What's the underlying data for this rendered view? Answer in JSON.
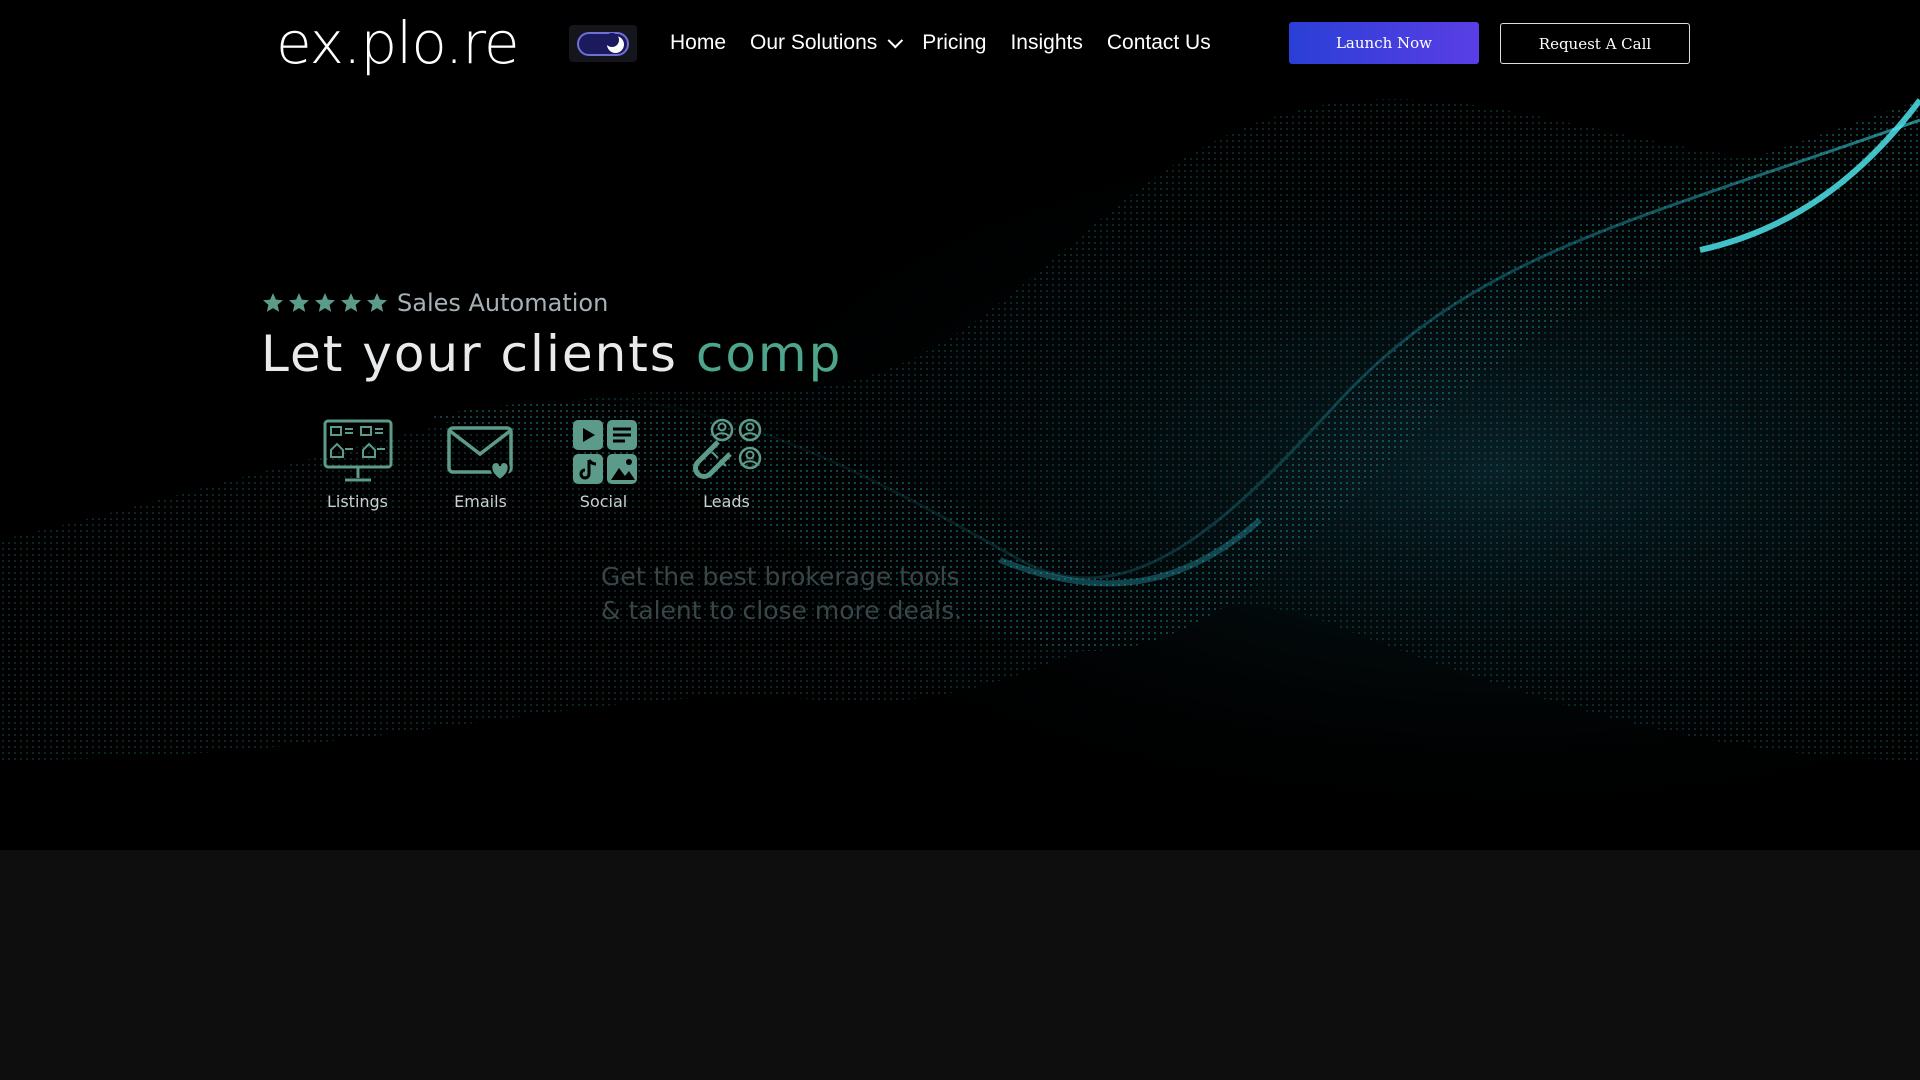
{
  "nav": {
    "logo": "ex.plo.re",
    "theme_toggle": "dark",
    "menu": [
      {
        "label": "Home"
      },
      {
        "label": "Our Solutions",
        "has_dropdown": true
      },
      {
        "label": "Pricing"
      },
      {
        "label": "Insights"
      },
      {
        "label": "Contact Us"
      }
    ],
    "launch_button": "Launch Now",
    "call_button": "Request A Call"
  },
  "hero": {
    "rating_stars": 5,
    "eyebrow": "Sales Automation",
    "headline_main": "Let your clients",
    "headline_accent": "comp",
    "features": [
      {
        "label": "Listings",
        "icon": "listings-monitor-icon"
      },
      {
        "label": "Emails",
        "icon": "email-heart-icon"
      },
      {
        "label": "Social",
        "icon": "social-media-icon"
      },
      {
        "label": "Leads",
        "icon": "leads-magnet-icon"
      }
    ],
    "subtext_line1": "Get the best brokerage tools",
    "subtext_line2": "& talent to close more deals."
  },
  "colors": {
    "accent_green": "#4da58b",
    "launch_gradient_start": "#2a3fd6",
    "launch_gradient_end": "#5a3ee6",
    "wave_cyan": "#2ec8d8"
  }
}
